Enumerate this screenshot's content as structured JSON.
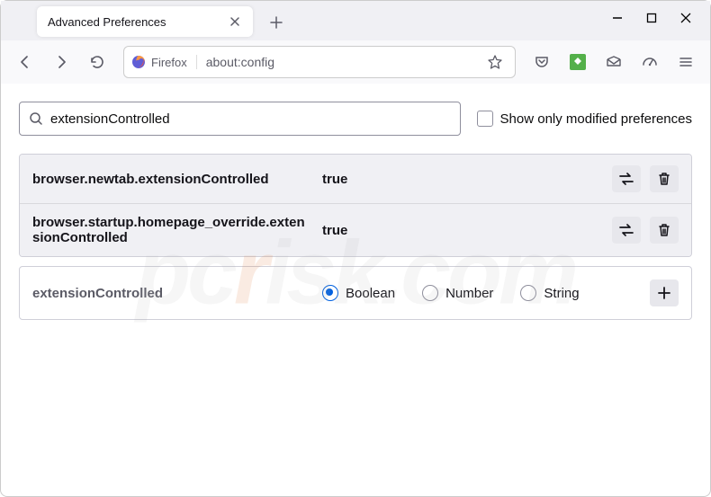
{
  "tab": {
    "title": "Advanced Preferences"
  },
  "urlbar": {
    "identity": "Firefox",
    "url": "about:config"
  },
  "search": {
    "value": "extensionControlled",
    "checkbox_label": "Show only modified preferences"
  },
  "prefs": [
    {
      "name": "browser.newtab.extensionControlled",
      "value": "true"
    },
    {
      "name": "browser.startup.homepage_override.extensionControlled",
      "value": "true"
    }
  ],
  "new_pref": {
    "name": "extensionControlled",
    "types": [
      "Boolean",
      "Number",
      "String"
    ]
  },
  "watermark": {
    "p": "p",
    "c": "c",
    "r": "r",
    "rest": "isk.com"
  }
}
